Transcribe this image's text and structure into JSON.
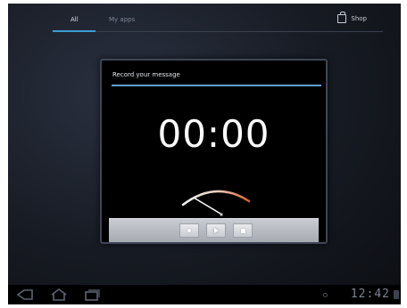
{
  "tabs": [
    {
      "label": "All",
      "selected": true
    },
    {
      "label": "My apps",
      "selected": false
    }
  ],
  "shop": {
    "label": "Shop",
    "icon": "shopping-bag-icon"
  },
  "dialog": {
    "title": "Record your message",
    "timer": "00:00",
    "controls": [
      {
        "name": "record",
        "icon": "record-dot-icon"
      },
      {
        "name": "play",
        "icon": "play-icon"
      },
      {
        "name": "stop",
        "icon": "stop-icon"
      }
    ]
  },
  "system_bar": {
    "clock": "12:42",
    "nav": [
      "back-icon",
      "home-icon",
      "recent-apps-icon"
    ]
  },
  "colors": {
    "accent_blue": "#3b9ed8",
    "meter_start": "#e8e8e8",
    "meter_end": "#e0602a"
  }
}
